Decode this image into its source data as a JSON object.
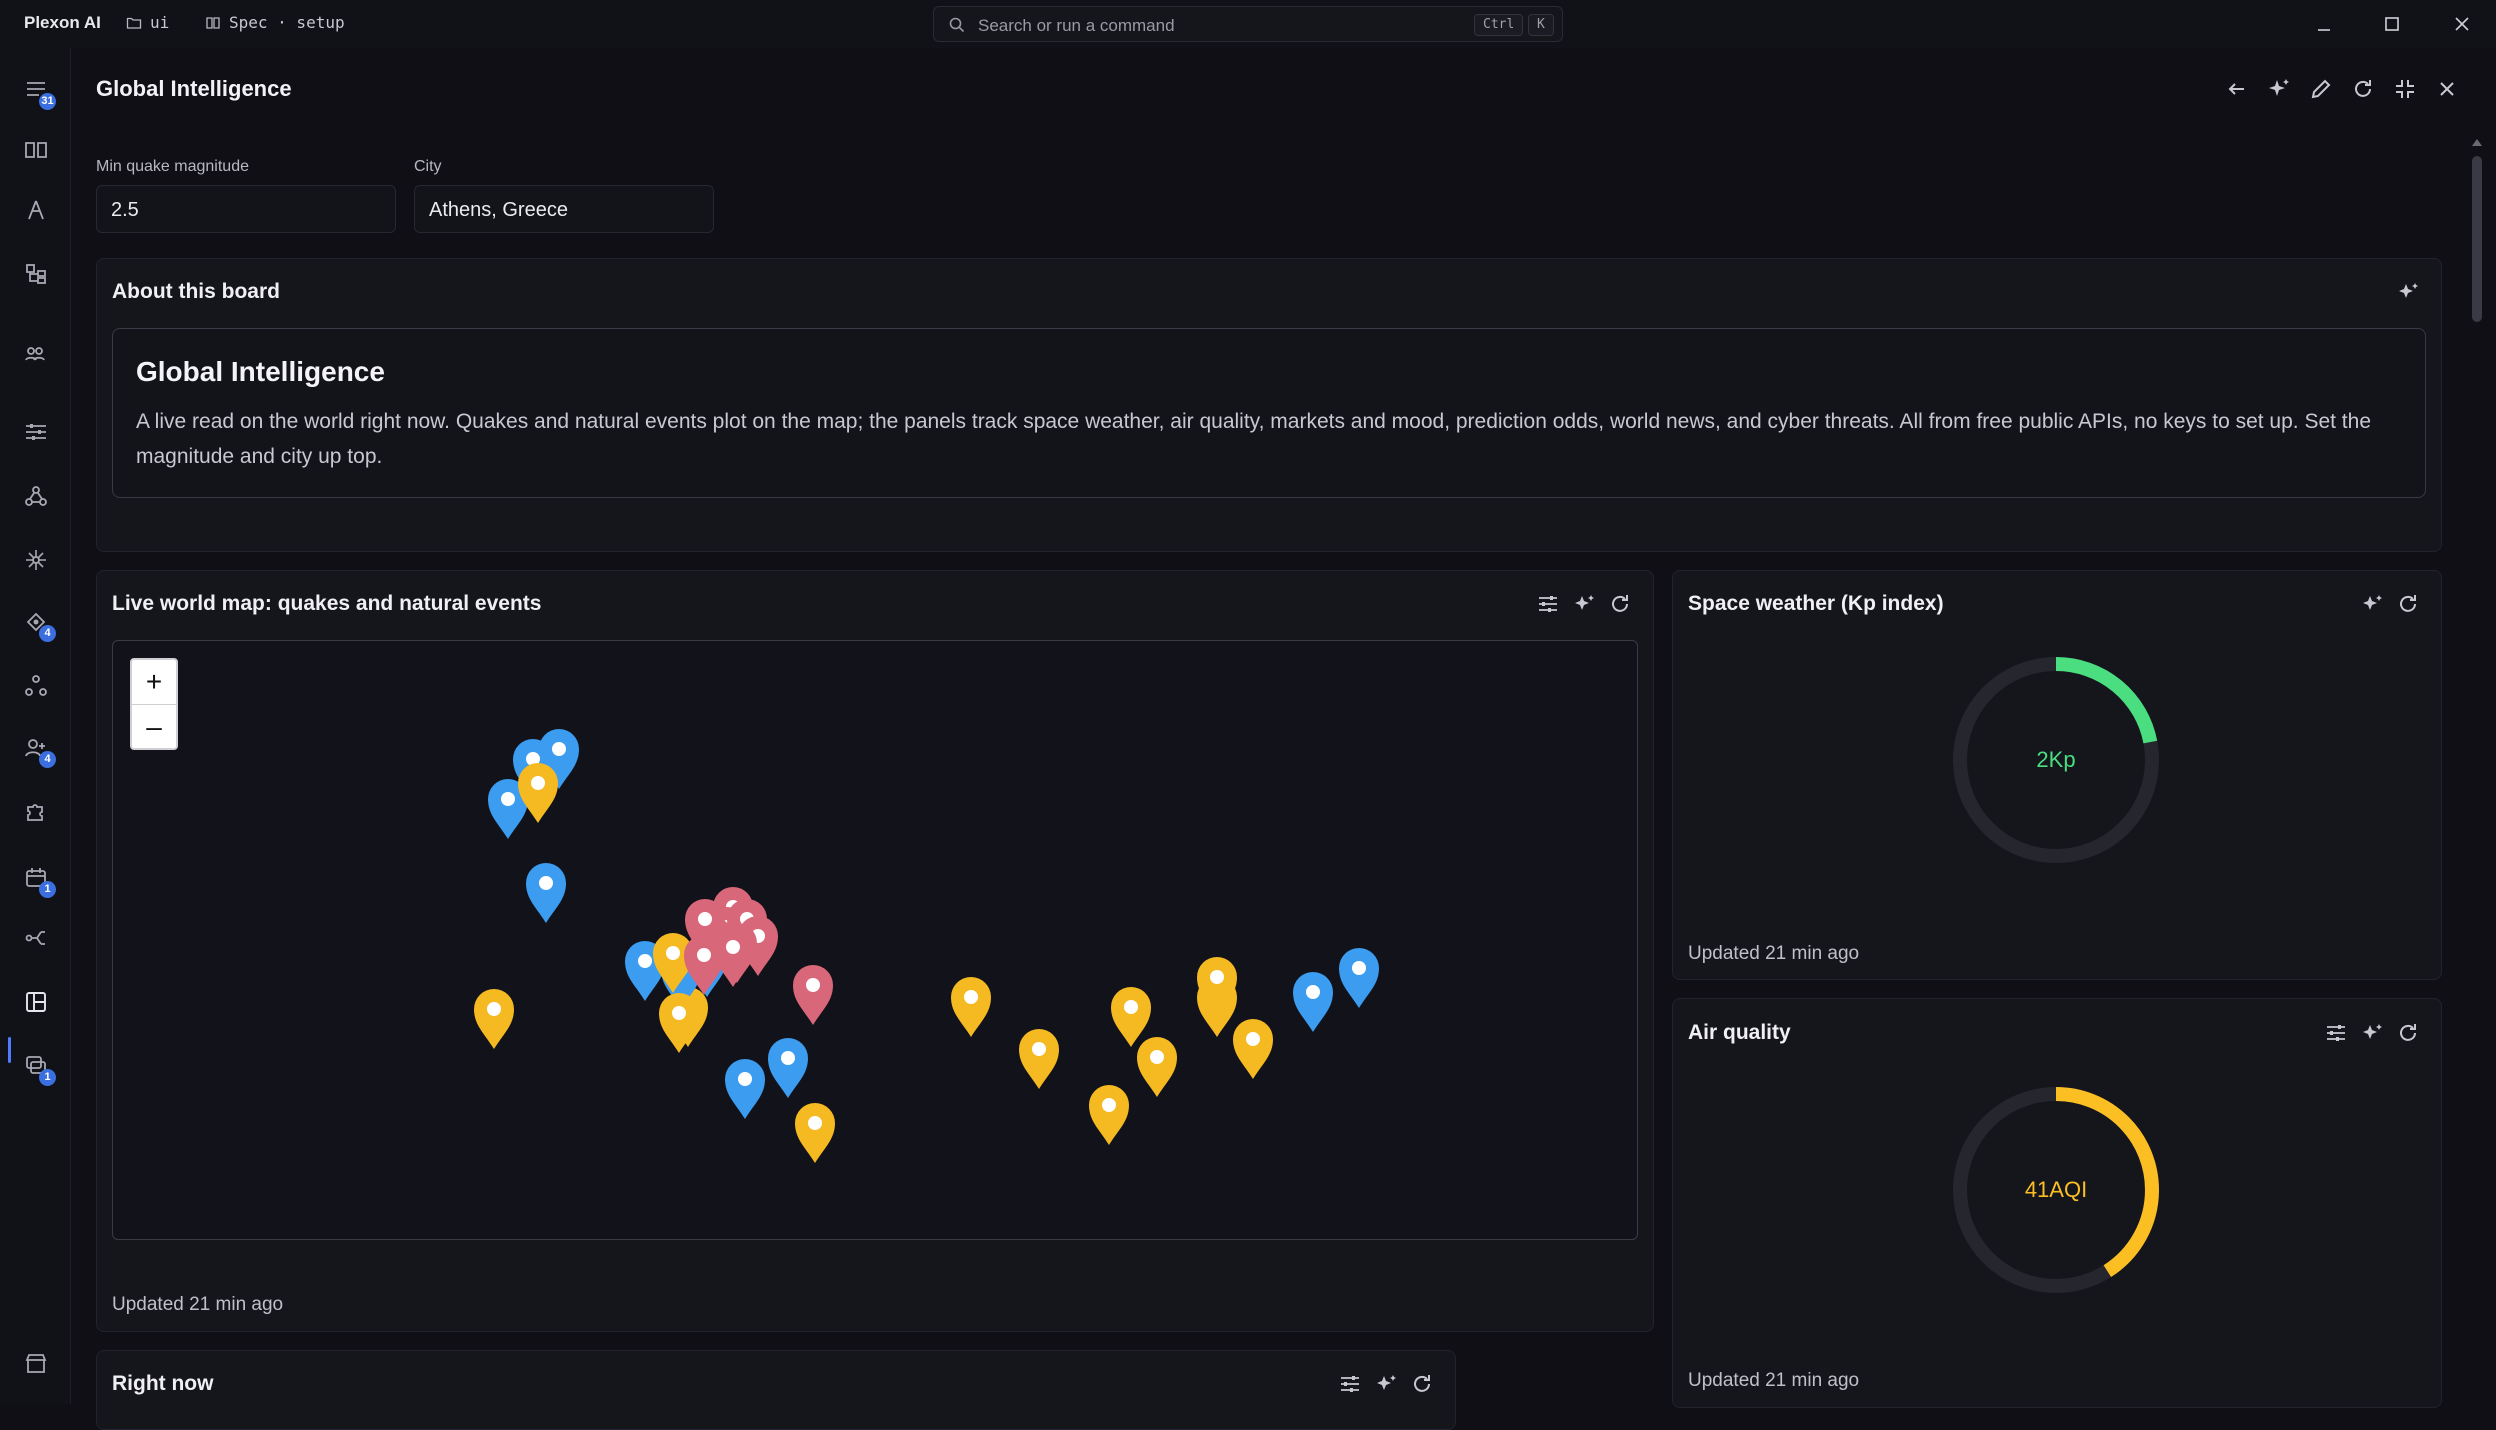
{
  "titlebar": {
    "app_name": "Plexon AI",
    "crumb_folder": "ui",
    "crumb_doc": "Spec · setup",
    "search_placeholder": "Search or run a command",
    "kbd_ctrl": "Ctrl",
    "kbd_k": "K"
  },
  "sidebar": {
    "badges": {
      "tasks": "31",
      "agents": "4",
      "people": "4",
      "calendar": "1",
      "chat": "1"
    }
  },
  "page": {
    "title": "Global Intelligence"
  },
  "filters": {
    "magnitude_label": "Min quake magnitude",
    "magnitude_value": "2.5",
    "city_label": "City",
    "city_value": "Athens, Greece"
  },
  "about": {
    "panel_title": "About this board",
    "heading": "Global Intelligence",
    "body": "A live read on the world right now. Quakes and natural events plot on the map; the panels track space weather, air quality, markets and mood, prediction odds, world news, and cyber threats. All from free public APIs, no keys to set up. Set the magnitude and city up top."
  },
  "map_panel": {
    "title": "Live world map: quakes and natural events",
    "zoom_in": "+",
    "zoom_out": "–",
    "updated": "Updated 21 min ago",
    "colors": {
      "quake": "#3b9cf0",
      "event": "#f5b922",
      "cluster": "#d9677a"
    }
  },
  "space_weather": {
    "title": "Space weather (Kp index)",
    "value": "2Kp",
    "fraction": 0.22,
    "color": "#4ade80",
    "updated": "Updated 21 min ago"
  },
  "air_quality": {
    "title": "Air quality",
    "value": "41AQI",
    "fraction": 0.41,
    "color": "#fbbf24",
    "updated": "Updated 21 min ago"
  },
  "right_now": {
    "title": "Right now"
  }
}
